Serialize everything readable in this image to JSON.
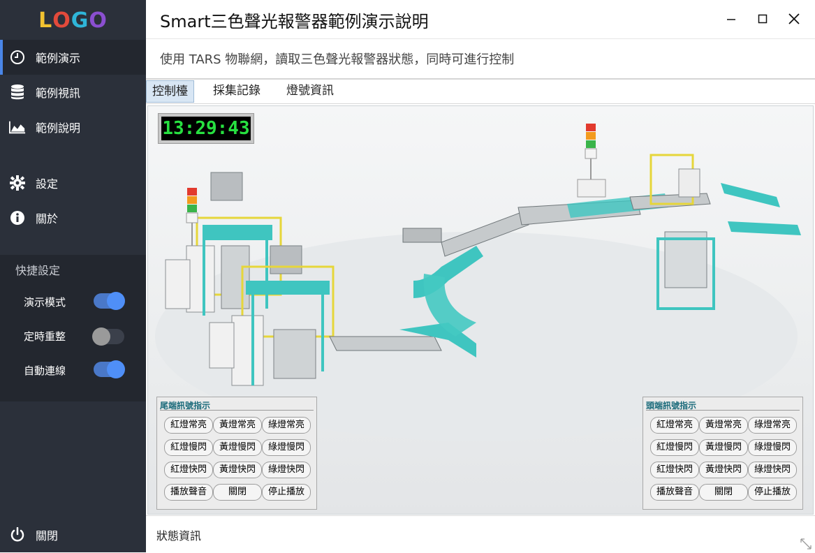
{
  "sidebar": {
    "logo": [
      "L",
      "O",
      "G",
      "O"
    ],
    "items": [
      {
        "label": "範例演示",
        "icon": "clock-icon"
      },
      {
        "label": "範例視訊",
        "icon": "database-icon"
      },
      {
        "label": "範例說明",
        "icon": "area-chart-icon"
      },
      {
        "label": "設定",
        "icon": "gear-icon"
      },
      {
        "label": "關於",
        "icon": "info-icon"
      }
    ],
    "quick": {
      "title": "快捷設定",
      "toggles": [
        {
          "label": "演示模式",
          "on": true
        },
        {
          "label": "定時重整",
          "on": false
        },
        {
          "label": "自動連線",
          "on": true
        }
      ]
    },
    "close_label": "關閉",
    "close_icon": "power-icon"
  },
  "window": {
    "title": "Smart三色聲光報警器範例演示說明",
    "subtitle": "使用 TARS 物聯網，讀取三色聲光報警器狀態，同時可進行控制"
  },
  "tabs": [
    {
      "label": "控制檯"
    },
    {
      "label": "採集記錄"
    },
    {
      "label": "燈號資訊"
    }
  ],
  "clock": "13:29:43",
  "panels": {
    "tail": {
      "title": "尾端訊號指示",
      "buttons": [
        [
          "紅燈常亮",
          "黃燈常亮",
          "綠燈常亮"
        ],
        [
          "紅燈慢閃",
          "黃燈慢閃",
          "綠燈慢閃"
        ],
        [
          "紅燈快閃",
          "黃燈快閃",
          "綠燈快閃"
        ],
        [
          "播放聲音",
          "關閉",
          "停止播放"
        ]
      ]
    },
    "head": {
      "title": "頭端訊號指示",
      "buttons": [
        [
          "紅燈常亮",
          "黃燈常亮",
          "綠燈常亮"
        ],
        [
          "紅燈慢閃",
          "黃燈慢閃",
          "綠燈慢閃"
        ],
        [
          "紅燈快閃",
          "黃燈快閃",
          "綠燈快閃"
        ],
        [
          "播放聲音",
          "關閉",
          "停止播放"
        ]
      ]
    }
  },
  "status": "狀態資訊",
  "colors": {
    "accent": "#4a86e8",
    "sidebar": "#2b303a",
    "clock_text": "#27e040"
  }
}
